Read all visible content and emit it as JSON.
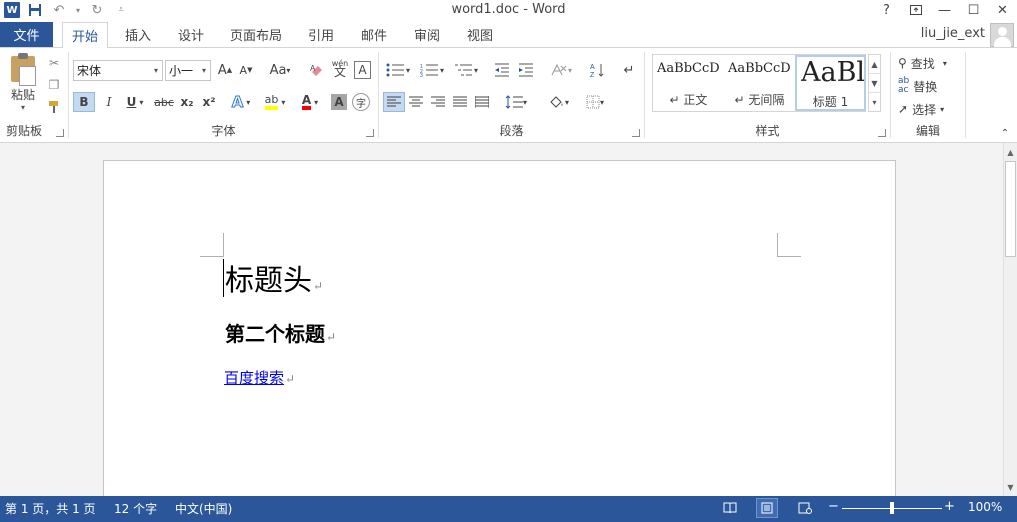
{
  "titlebar": {
    "title": "word1.doc - Word",
    "icons": [
      "word-logo",
      "save-icon",
      "undo-icon",
      "redo-icon",
      "customize-qa-icon"
    ],
    "word_logo_letter": "W",
    "help": "?",
    "ribbon_display": "⇱",
    "minimize": "—",
    "maximize": "☐",
    "close": "✕"
  },
  "tabs": {
    "file": "文件",
    "items": [
      "开始",
      "插入",
      "设计",
      "页面布局",
      "引用",
      "邮件",
      "审阅",
      "视图"
    ],
    "active": "开始",
    "user": "liu_jie_ext"
  },
  "ribbon": {
    "clipboard": {
      "label": "剪贴板",
      "paste": "粘贴"
    },
    "font": {
      "label": "字体",
      "font_name": "宋体",
      "font_size": "小一",
      "grow": "A",
      "shrink": "A",
      "change_case": "Aa",
      "phonetic": "wén",
      "phonetic_char": "文",
      "border_char": "A",
      "bold": "B",
      "italic": "I",
      "underline": "U",
      "strike": "abc",
      "subscript": "x₂",
      "superscript": "x²",
      "text_effect": "A",
      "highlight": "ab",
      "font_color": "A",
      "char_shading": "A",
      "enclose": "字"
    },
    "paragraph": {
      "label": "段落"
    },
    "styles": {
      "label": "样式",
      "items": [
        {
          "sample": "AaBbCcDc",
          "name": "正文"
        },
        {
          "sample": "AaBbCcDc",
          "name": "无间隔"
        },
        {
          "sample": "AaBl",
          "name": "标题 1"
        }
      ]
    },
    "editing": {
      "label": "编辑",
      "find": "查找",
      "replace": "替换",
      "select": "选择"
    }
  },
  "document": {
    "heading1": "标题头",
    "heading2": "第二个标题",
    "link_text": "百度搜索",
    "para_mark": "↵"
  },
  "statusbar": {
    "page": "第 1 页，共 1 页",
    "words": "12 个字",
    "language": "中文(中国)",
    "zoom": "100%",
    "zoom_minus": "−",
    "zoom_plus": "+",
    "zoom_fraction": 0.5
  },
  "colors": {
    "accent": "#2b579a",
    "highlight_yellow": "#ffff00",
    "font_red": "#ff0000",
    "link_blue": "#0000ee"
  }
}
